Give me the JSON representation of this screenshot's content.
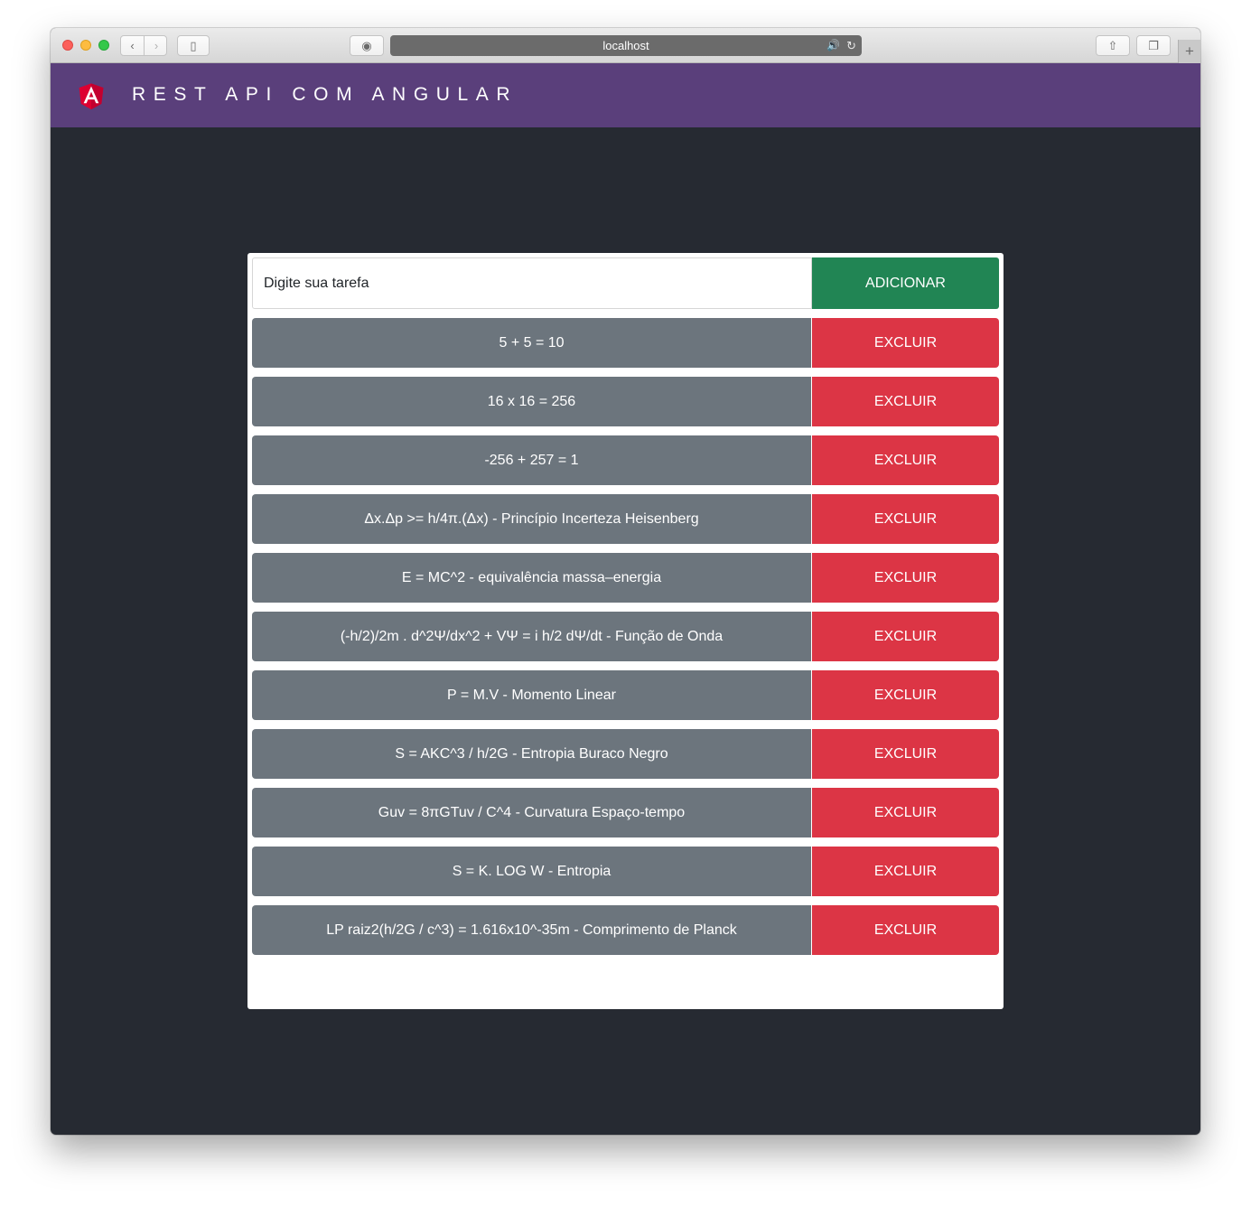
{
  "browser": {
    "url": "localhost",
    "back_glyph": "‹",
    "forward_glyph": "›",
    "sidebar_glyph": "▯",
    "shield_glyph": "◉",
    "speaker_glyph": "🔊",
    "reload_glyph": "↻",
    "share_glyph": "⇧",
    "tabs_glyph": "❐",
    "newtab_glyph": "+"
  },
  "app": {
    "logo_letter": "A",
    "title": "REST API COM ANGULAR"
  },
  "form": {
    "placeholder": "Digite sua tarefa",
    "add_label": "ADICIONAR"
  },
  "tasks": [
    {
      "label": "5 + 5 = 10",
      "button": "EXCLUIR"
    },
    {
      "label": "16 x 16 = 256",
      "button": "EXCLUIR"
    },
    {
      "label": "-256 + 257 = 1",
      "button": "EXCLUIR"
    },
    {
      "label": "Δx.Δp >= h/4π.(Δx) - Princípio Incerteza Heisenberg",
      "button": "EXCLUIR"
    },
    {
      "label": "E = MC^2 - equivalência massa–energia",
      "button": "EXCLUIR"
    },
    {
      "label": "(-h/2)/2m . d^2Ψ/dx^2 + VΨ = i h/2 dΨ/dt - Função de Onda",
      "button": "EXCLUIR"
    },
    {
      "label": "P = M.V - Momento Linear",
      "button": "EXCLUIR"
    },
    {
      "label": "S = AKC^3 / h/2G - Entropia Buraco Negro",
      "button": "EXCLUIR"
    },
    {
      "label": "Guv = 8πGTuv / C^4 - Curvatura Espaço-tempo",
      "button": "EXCLUIR"
    },
    {
      "label": "S = K. LOG W - Entropia",
      "button": "EXCLUIR"
    },
    {
      "label": "LP raiz2(h/2G / c^3) = 1.616x10^-35m - Comprimento de Planck",
      "button": "EXCLUIR"
    }
  ],
  "colors": {
    "header": "#5a3f7b",
    "background": "#262a32",
    "task_bg": "#6c757d",
    "add_button": "#218554",
    "delete_button": "#dc3545",
    "logo_red": "#dd0031"
  }
}
